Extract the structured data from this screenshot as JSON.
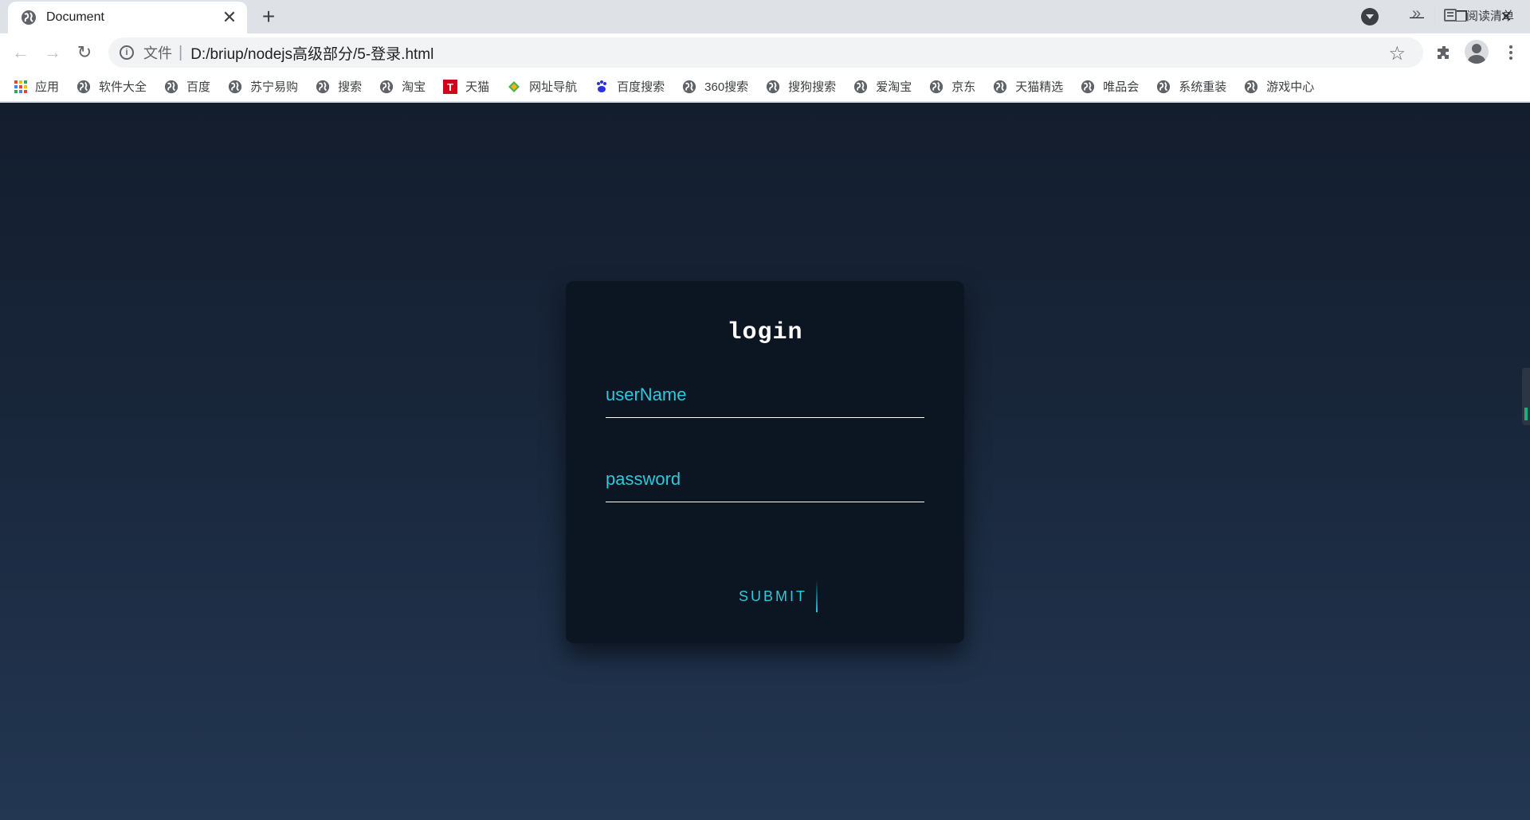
{
  "browser": {
    "tab": {
      "title": "Document",
      "close_glyph": "✕"
    },
    "new_tab_glyph": "+",
    "window_controls": {
      "minimize": "—",
      "restore": "❐",
      "close": "✕"
    },
    "toolbar": {
      "back_glyph": "←",
      "forward_glyph": "→",
      "reload_glyph": "↻",
      "scheme_label": "文件",
      "separator": "|",
      "url": "D:/briup/nodejs高级部分/5-登录.html",
      "star_glyph": "☆"
    },
    "bookmarks": [
      {
        "label": "应用",
        "icon": "apps-grid-icon"
      },
      {
        "label": "软件大全",
        "icon": "globe-icon"
      },
      {
        "label": "百度",
        "icon": "globe-icon"
      },
      {
        "label": "苏宁易购",
        "icon": "globe-icon"
      },
      {
        "label": "搜索",
        "icon": "globe-icon"
      },
      {
        "label": "淘宝",
        "icon": "globe-icon"
      },
      {
        "label": "天猫",
        "icon": "tmall-icon"
      },
      {
        "label": "网址导航",
        "icon": "nav-icon"
      },
      {
        "label": "百度搜索",
        "icon": "baidu-paw-icon"
      },
      {
        "label": "360搜索",
        "icon": "globe-icon"
      },
      {
        "label": "搜狗搜索",
        "icon": "globe-icon"
      },
      {
        "label": "爱淘宝",
        "icon": "globe-icon"
      },
      {
        "label": "京东",
        "icon": "globe-icon"
      },
      {
        "label": "天猫精选",
        "icon": "globe-icon"
      },
      {
        "label": "唯品会",
        "icon": "globe-icon"
      },
      {
        "label": "系统重装",
        "icon": "globe-icon"
      },
      {
        "label": "游戏中心",
        "icon": "globe-icon"
      }
    ],
    "bookmarks_overflow": "»",
    "reading_list": "阅读清单"
  },
  "login": {
    "title": "login",
    "username_label": "userName",
    "password_label": "password",
    "submit_label": "SUBMIT"
  },
  "colors": {
    "accent": "#2dc9dc",
    "card": "#0c1522",
    "bg_top": "#131d2d",
    "bg_bottom": "#233752"
  }
}
